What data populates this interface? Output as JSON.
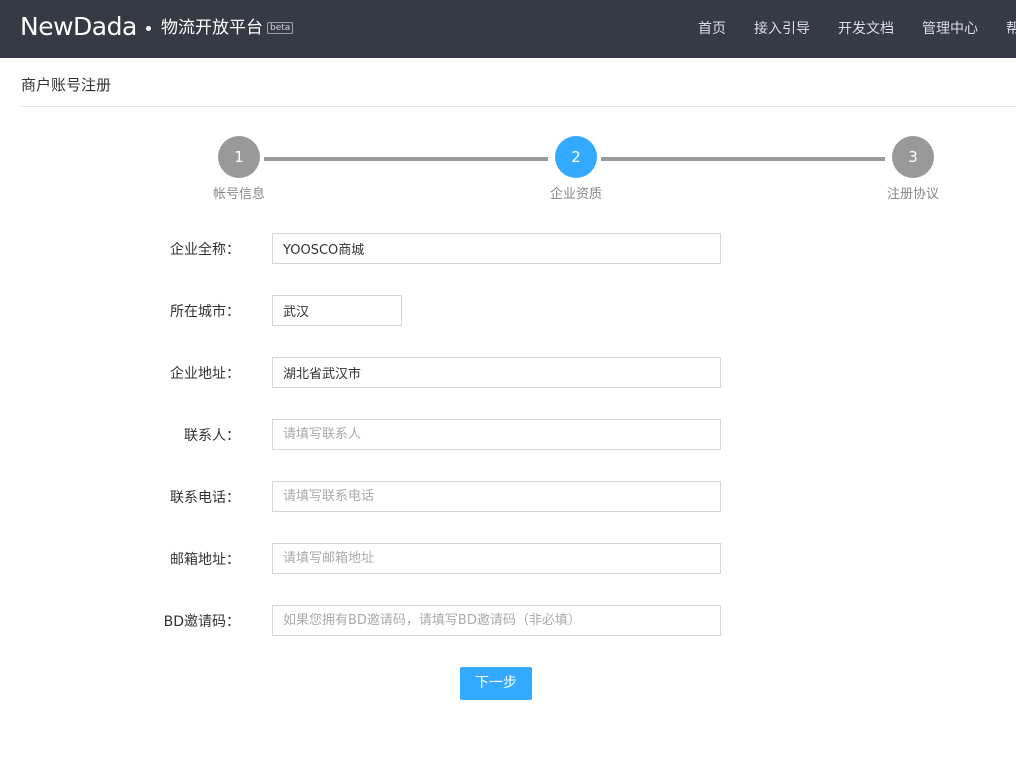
{
  "header": {
    "logo": "NewDada",
    "platform_title": "物流开放平台",
    "beta": "beta",
    "nav": [
      "首页",
      "接入引导",
      "开发文档",
      "管理中心",
      "帮"
    ]
  },
  "page": {
    "title": "商户账号注册"
  },
  "steps": [
    {
      "number": "1",
      "label": "帐号信息",
      "active": false
    },
    {
      "number": "2",
      "label": "企业资质",
      "active": true
    },
    {
      "number": "3",
      "label": "注册协议",
      "active": false
    }
  ],
  "form": {
    "company_name": {
      "label": "企业全称：",
      "value": "YOOSCO商城",
      "placeholder": ""
    },
    "city": {
      "label": "所在城市：",
      "value": "武汉",
      "placeholder": ""
    },
    "address": {
      "label": "企业地址：",
      "value": "湖北省武汉市",
      "placeholder": ""
    },
    "contact": {
      "label": "联系人：",
      "value": "",
      "placeholder": "请填写联系人"
    },
    "phone": {
      "label": "联系电话：",
      "value": "",
      "placeholder": "请填写联系电话"
    },
    "email": {
      "label": "邮箱地址：",
      "value": "",
      "placeholder": "请填写邮箱地址"
    },
    "bd_code": {
      "label": "BD邀请码：",
      "value": "",
      "placeholder": "如果您拥有BD邀请码，请填写BD邀请码（非必填）"
    },
    "next_label": "下一步"
  },
  "colors": {
    "header_bg": "#363a45",
    "accent": "#33aaff",
    "step_inactive": "#999999"
  }
}
